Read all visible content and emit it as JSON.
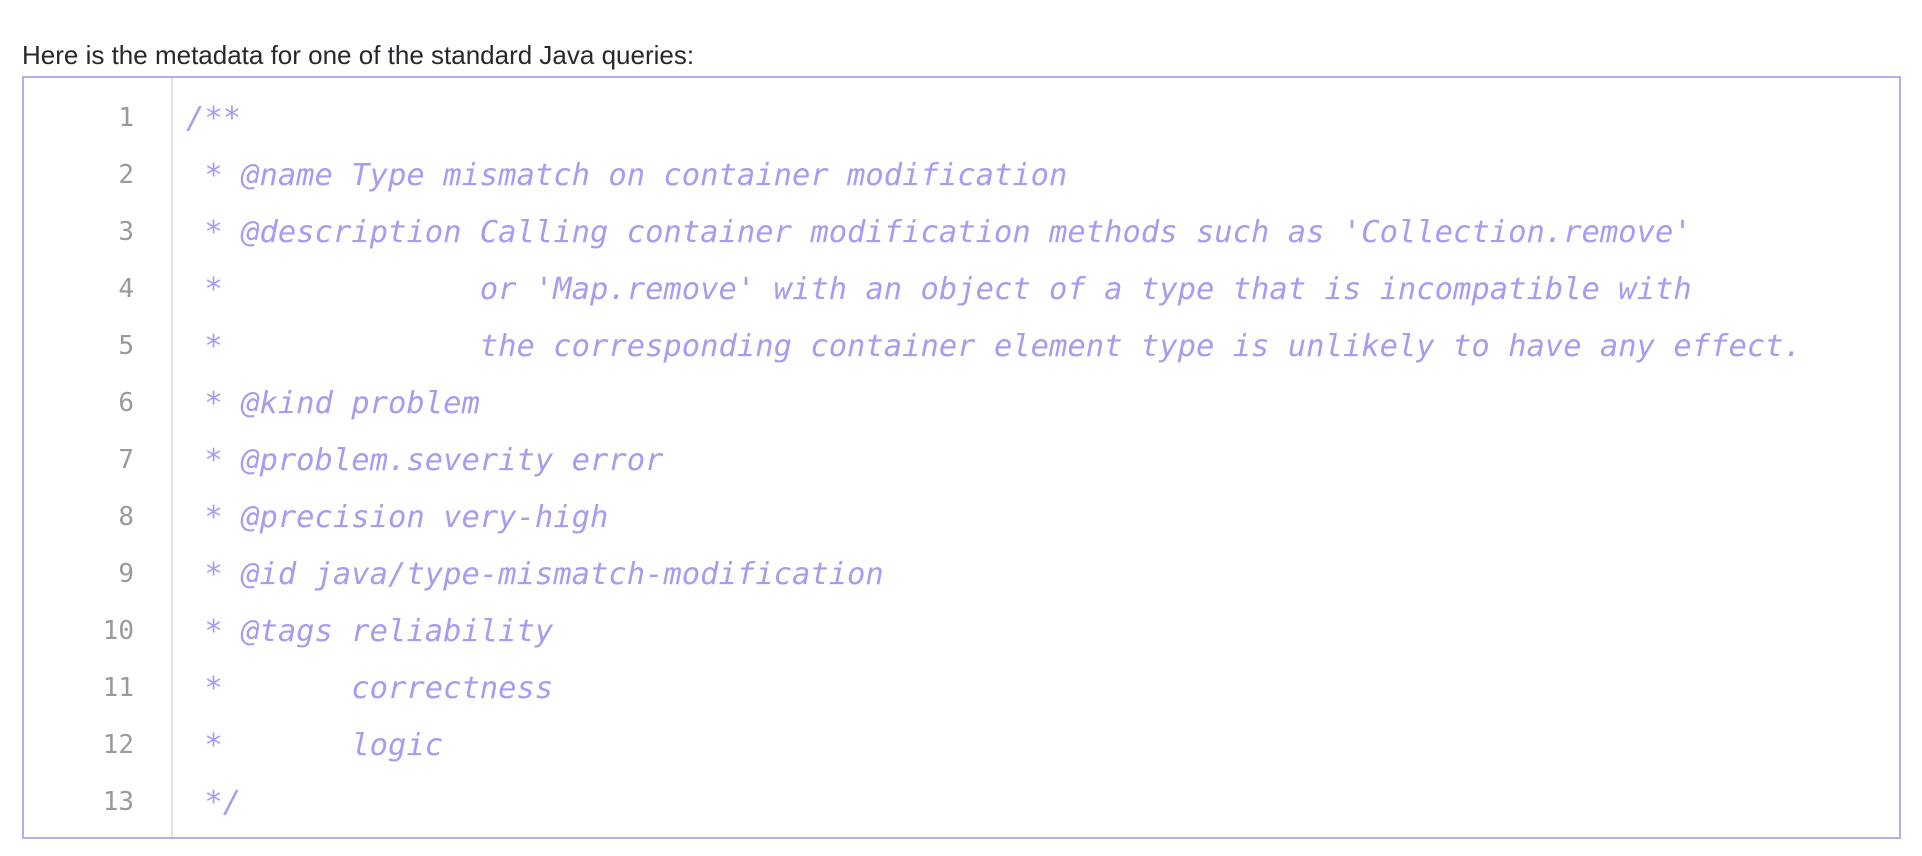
{
  "intro_text": "Here is the metadata for one of the standard Java queries:",
  "code": {
    "language": "java",
    "text_color": "#a69cf0",
    "border_color": "#b4acef",
    "lines": [
      {
        "number": "1",
        "text": "/**"
      },
      {
        "number": "2",
        "text": " * @name Type mismatch on container modification"
      },
      {
        "number": "3",
        "text": " * @description Calling container modification methods such as 'Collection.remove'"
      },
      {
        "number": "4",
        "text": " *              or 'Map.remove' with an object of a type that is incompatible with"
      },
      {
        "number": "5",
        "text": " *              the corresponding container element type is unlikely to have any effect."
      },
      {
        "number": "6",
        "text": " * @kind problem"
      },
      {
        "number": "7",
        "text": " * @problem.severity error"
      },
      {
        "number": "8",
        "text": " * @precision very-high"
      },
      {
        "number": "9",
        "text": " * @id java/type-mismatch-modification"
      },
      {
        "number": "10",
        "text": " * @tags reliability"
      },
      {
        "number": "11",
        "text": " *       correctness"
      },
      {
        "number": "12",
        "text": " *       logic"
      },
      {
        "number": "13",
        "text": " */"
      }
    ]
  }
}
